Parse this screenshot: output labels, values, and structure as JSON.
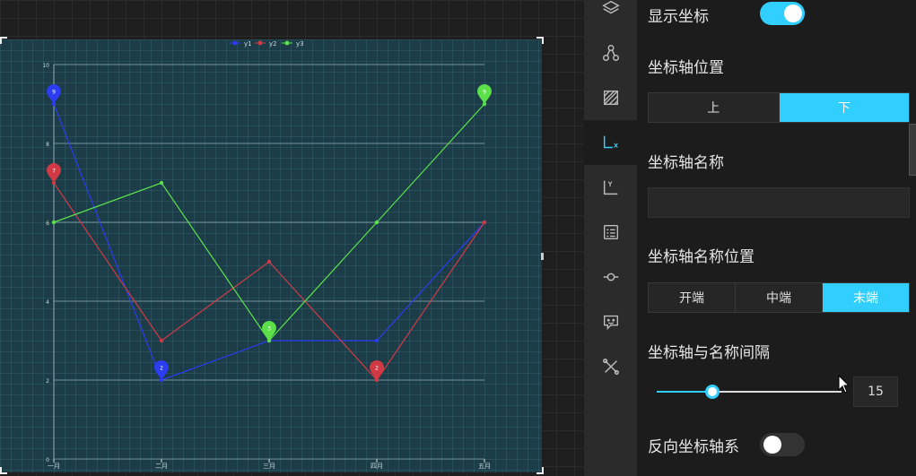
{
  "chart_data": {
    "type": "line",
    "categories": [
      "一月",
      "二月",
      "三月",
      "四月",
      "五月"
    ],
    "series": [
      {
        "name": "y1",
        "color": "#2b3cf2",
        "values": [
          9,
          2,
          3,
          3,
          6
        ]
      },
      {
        "name": "y2",
        "color": "#d13a45",
        "values": [
          7,
          3,
          5,
          2,
          6
        ]
      },
      {
        "name": "y3",
        "color": "#5ce04a",
        "values": [
          6,
          7,
          3,
          6,
          9
        ]
      }
    ],
    "ylim": [
      0,
      10
    ],
    "yticks": [
      0,
      2,
      4,
      6,
      8,
      10
    ],
    "grid": true,
    "legend": "top-center",
    "markers": [
      {
        "series": 0,
        "index": 0,
        "label": "9"
      },
      {
        "series": 0,
        "index": 1,
        "label": "2"
      },
      {
        "series": 1,
        "index": 0,
        "label": "7"
      },
      {
        "series": 1,
        "index": 3,
        "label": "2"
      },
      {
        "series": 2,
        "index": 2,
        "label": "3"
      },
      {
        "series": 2,
        "index": 4,
        "label": "9"
      }
    ]
  },
  "rail": {
    "items": [
      {
        "icon": "layers-icon"
      },
      {
        "icon": "nodes-icon"
      },
      {
        "icon": "pattern-icon"
      },
      {
        "icon": "x-axis-icon",
        "active": true
      },
      {
        "icon": "y-axis-icon"
      },
      {
        "icon": "list-icon"
      },
      {
        "icon": "line-marker-icon"
      },
      {
        "icon": "tooltip-icon"
      },
      {
        "icon": "tools-icon"
      }
    ],
    "accent": "#30cfff"
  },
  "settings": {
    "show_axis": {
      "label": "显示坐标",
      "on": true
    },
    "axis_position": {
      "label": "坐标轴位置",
      "options": [
        "上",
        "下"
      ],
      "selected": 1
    },
    "axis_name": {
      "label": "坐标轴名称",
      "value": "",
      "placeholder": ""
    },
    "name_position": {
      "label": "坐标轴名称位置",
      "options": [
        "开端",
        "中端",
        "末端"
      ],
      "selected": 2
    },
    "name_gap": {
      "label": "坐标轴与名称间隔",
      "value": "15",
      "fraction": 0.3
    },
    "inverse": {
      "label": "反向坐标轴系",
      "on": false
    }
  },
  "colors": {
    "accent": "#30cfff",
    "panel_bg": "#1c1c1c",
    "rail_bg": "#2b2b2b",
    "chart_bg": "#1c3d48"
  }
}
